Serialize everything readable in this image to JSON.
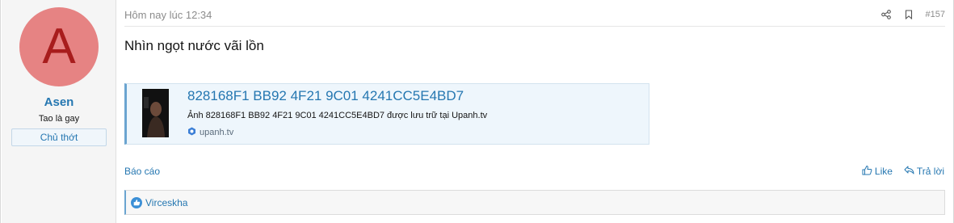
{
  "user": {
    "avatar_letter": "A",
    "avatar_bg": "#e68383",
    "name": "Asen",
    "title": "Tao là gay",
    "banner": "Chủ thớt"
  },
  "post": {
    "date": "Hôm nay lúc 12:34",
    "number": "#157",
    "text": "Nhìn ngọt nước vãi lồn",
    "header_icons": [
      "share-icon",
      "bookmark-icon"
    ]
  },
  "embed": {
    "title": "828168F1 BB92 4F21 9C01 4241CC5E4BD7",
    "description": "Ảnh 828168F1 BB92 4F21 9C01 4241CC5E4BD7 được lưu trữ tại Upanh.tv",
    "site": "upanh.tv"
  },
  "footer": {
    "report": "Báo cáo",
    "like": "Like",
    "reply": "Trả lời"
  },
  "reactions": {
    "users": "Virceskha"
  },
  "colors": {
    "link": "#2577b1",
    "accent": "#6aa4d0"
  }
}
